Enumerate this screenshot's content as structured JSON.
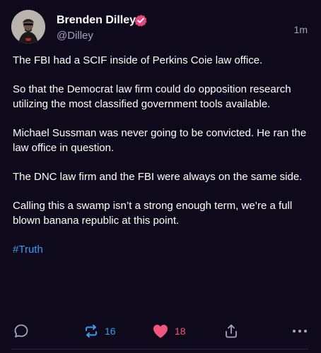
{
  "post": {
    "author": {
      "display_name": "Brenden Dilley",
      "handle": "@Dilley",
      "verified": true
    },
    "timestamp": "1m",
    "paragraphs": [
      "The FBI had a SCIF inside of Perkins Coie law office.",
      "So that the Democrat law firm could do opposition research utilizing the most classified government tools available.",
      "Michael Sussman was never going to be convicted. He ran the law office in question.",
      "The DNC law firm and the FBI were always on the same side.",
      "Calling this a swamp isn’t a strong enough term, we’re a full blown banana republic at this point."
    ],
    "hashtag": "#Truth"
  },
  "actions": {
    "reply_icon": "reply-icon",
    "repost_icon": "repost-icon",
    "repost_count": "16",
    "like_icon": "heart-icon",
    "like_count": "18",
    "share_icon": "share-icon",
    "more_icon": "more-icon"
  },
  "colors": {
    "background": "#0e0a1c",
    "text": "#ffffff",
    "muted": "#a8a3b8",
    "accent_blue": "#3b9cf0",
    "like_pink": "#f4557d",
    "verified_pink": "#e8457a"
  }
}
